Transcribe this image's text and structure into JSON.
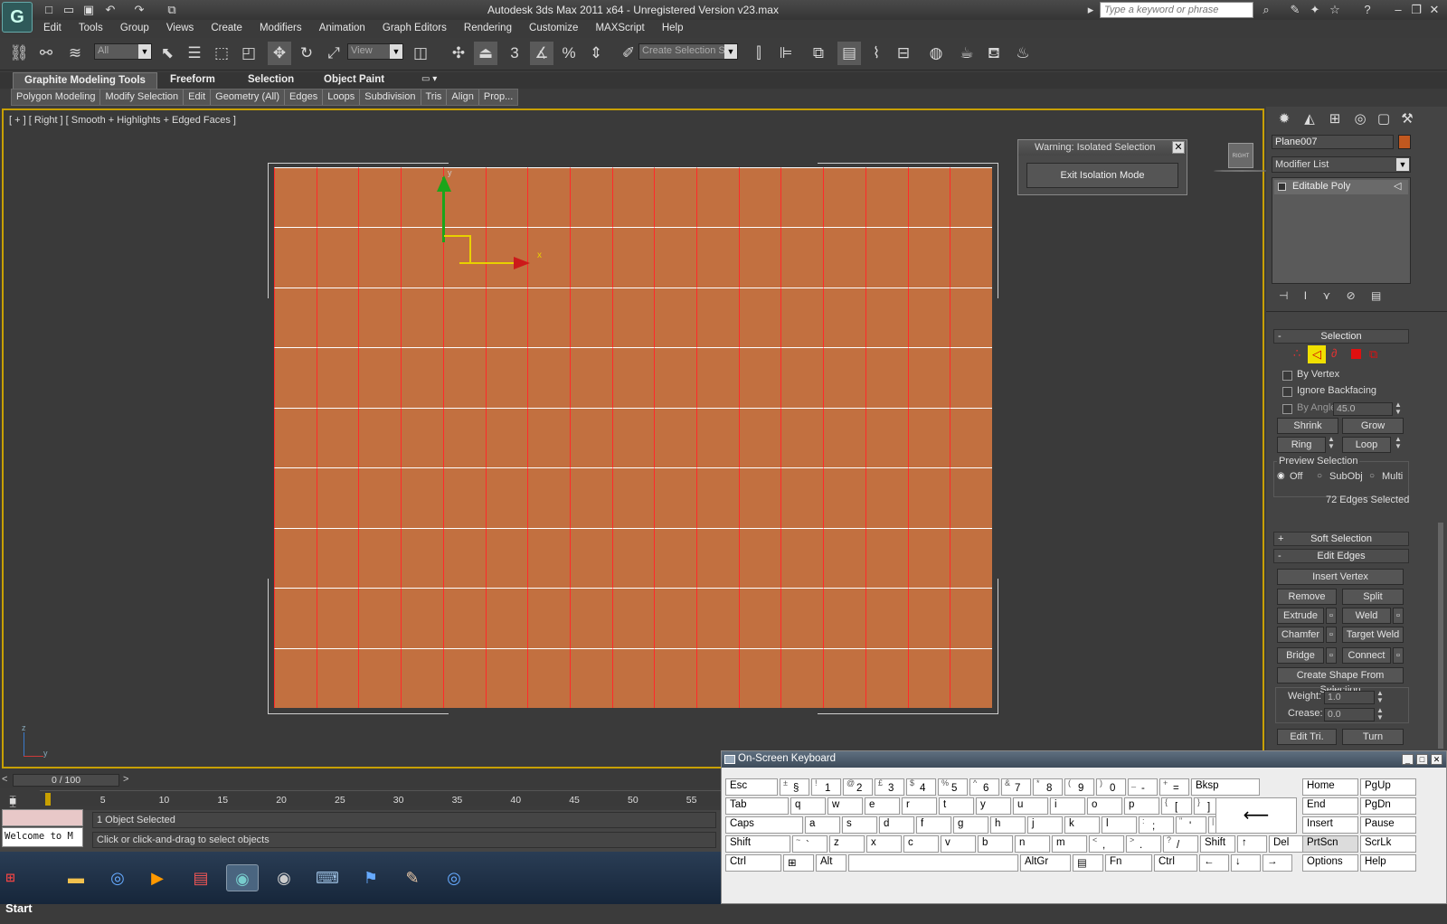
{
  "window": {
    "title": "Autodesk 3ds Max  2011 x64  - Unregistered Version   v23.max",
    "search_placeholder": "Type a keyword or phrase",
    "app_icon_glyph": "G"
  },
  "menu": [
    "Edit",
    "Tools",
    "Group",
    "Views",
    "Create",
    "Modifiers",
    "Animation",
    "Graph Editors",
    "Rendering",
    "Customize",
    "MAXScript",
    "Help"
  ],
  "toolbar": {
    "selection_filter": "All",
    "ref_coord": "View",
    "named_selection": "Create Selection Se"
  },
  "ribbon": {
    "tabs": [
      "Graphite Modeling Tools",
      "Freeform",
      "Selection",
      "Object Paint"
    ],
    "panels": [
      "Polygon Modeling",
      "Modify Selection",
      "Edit",
      "Geometry (All)",
      "Edges",
      "Loops",
      "Subdivision",
      "Tris",
      "Align",
      "Prop..."
    ]
  },
  "viewport": {
    "label": "[ + ] [ Right ] [ Smooth + Highlights + Edged Faces ]",
    "object_color": "#c27040",
    "grid_cols": 17,
    "grid_rows": 9,
    "gizmo_x": "x",
    "gizmo_y": "y",
    "axis_z": "z",
    "axis_y": "y",
    "viewcube_label": "RIGHT"
  },
  "warning_dialog": {
    "title": "Warning: Isolated Selection",
    "button": "Exit Isolation Mode"
  },
  "command_panel": {
    "object_name": "Plane007",
    "object_color": "#c1581f",
    "modifier_list": "Modifier List",
    "stack_item": "Editable Poly",
    "selection": {
      "title": "Selection",
      "by_vertex": "By Vertex",
      "ignore_backfacing": "Ignore Backfacing",
      "by_angle": "By Angle:",
      "angle_value": "45.0",
      "shrink": "Shrink",
      "grow": "Grow",
      "ring": "Ring",
      "loop": "Loop",
      "preview_title": "Preview Selection",
      "preview_off": "Off",
      "preview_subobj": "SubObj",
      "preview_multi": "Multi",
      "status": "72 Edges Selected"
    },
    "soft_selection": "Soft Selection",
    "edit_edges": {
      "title": "Edit Edges",
      "insert_vertex": "Insert Vertex",
      "remove": "Remove",
      "split": "Split",
      "extrude": "Extrude",
      "weld": "Weld",
      "chamfer": "Chamfer",
      "target_weld": "Target Weld",
      "bridge": "Bridge",
      "connect": "Connect",
      "create_shape": "Create Shape From Selection",
      "weight_label": "Weight:",
      "weight_value": "1.0",
      "crease_label": "Crease:",
      "crease_value": "0.0",
      "edit_tri": "Edit Tri.",
      "turn": "Turn"
    }
  },
  "timeline": {
    "slider": "0 / 100",
    "ticks": [
      "0",
      "5",
      "10",
      "15",
      "20",
      "25",
      "30",
      "35",
      "40",
      "45",
      "50",
      "55"
    ]
  },
  "status": {
    "script_text": "Welcome to M",
    "line1": "1 Object Selected",
    "line2": "Click or click-and-drag to select objects"
  },
  "taskbar": {
    "start": "Start"
  },
  "osk": {
    "title": "On-Screen Keyboard",
    "row1": [
      {
        "t": "",
        "m": "Esc"
      },
      {
        "t": "±",
        "m": "§"
      },
      {
        "t": "!",
        "m": "1"
      },
      {
        "t": "@",
        "m": "2"
      },
      {
        "t": "£",
        "m": "3"
      },
      {
        "t": "$",
        "m": "4"
      },
      {
        "t": "%",
        "m": "5"
      },
      {
        "t": "^",
        "m": "6"
      },
      {
        "t": "&",
        "m": "7"
      },
      {
        "t": "*",
        "m": "8"
      },
      {
        "t": "(",
        "m": "9"
      },
      {
        "t": ")",
        "m": "0"
      },
      {
        "t": "_",
        "m": "-"
      },
      {
        "t": "+",
        "m": "="
      },
      {
        "t": "",
        "m": "Bksp"
      }
    ],
    "row2": [
      {
        "t": "",
        "m": "Tab"
      },
      {
        "t": "",
        "m": "q"
      },
      {
        "t": "",
        "m": "w"
      },
      {
        "t": "",
        "m": "e"
      },
      {
        "t": "",
        "m": "r"
      },
      {
        "t": "",
        "m": "t"
      },
      {
        "t": "",
        "m": "y"
      },
      {
        "t": "",
        "m": "u"
      },
      {
        "t": "",
        "m": "i"
      },
      {
        "t": "",
        "m": "o"
      },
      {
        "t": "",
        "m": "p"
      },
      {
        "t": "{",
        "m": "["
      },
      {
        "t": "}",
        "m": "]"
      }
    ],
    "row3": [
      {
        "t": "",
        "m": "Caps"
      },
      {
        "t": "",
        "m": "a"
      },
      {
        "t": "",
        "m": "s"
      },
      {
        "t": "",
        "m": "d"
      },
      {
        "t": "",
        "m": "f"
      },
      {
        "t": "",
        "m": "g"
      },
      {
        "t": "",
        "m": "h"
      },
      {
        "t": "",
        "m": "j"
      },
      {
        "t": "",
        "m": "k"
      },
      {
        "t": "",
        "m": "l"
      },
      {
        "t": ":",
        "m": ";"
      },
      {
        "t": "\"",
        "m": "'"
      },
      {
        "t": "|",
        "m": "\\"
      }
    ],
    "row4": [
      {
        "t": "",
        "m": "Shift"
      },
      {
        "t": "~",
        "m": "`"
      },
      {
        "t": "",
        "m": "z"
      },
      {
        "t": "",
        "m": "x"
      },
      {
        "t": "",
        "m": "c"
      },
      {
        "t": "",
        "m": "v"
      },
      {
        "t": "",
        "m": "b"
      },
      {
        "t": "",
        "m": "n"
      },
      {
        "t": "",
        "m": "m"
      },
      {
        "t": "<",
        "m": ","
      },
      {
        "t": ">",
        "m": "."
      },
      {
        "t": "?",
        "m": "/"
      },
      {
        "t": "",
        "m": "Shift"
      },
      {
        "t": "",
        "m": "↑"
      },
      {
        "t": "",
        "m": "Del"
      }
    ],
    "row5": [
      {
        "t": "",
        "m": "Ctrl"
      },
      {
        "t": "",
        "m": "⊞"
      },
      {
        "t": "",
        "m": "Alt"
      },
      {
        "t": "",
        "m": ""
      },
      {
        "t": "",
        "m": "AltGr"
      },
      {
        "t": "",
        "m": "▤"
      },
      {
        "t": "",
        "m": "Fn"
      },
      {
        "t": "",
        "m": "Ctrl"
      },
      {
        "t": "",
        "m": "←"
      },
      {
        "t": "",
        "m": "↓"
      },
      {
        "t": "",
        "m": "→"
      }
    ],
    "nav": [
      "Home",
      "PgUp",
      "End",
      "PgDn",
      "Insert",
      "Pause",
      "PrtScn",
      "ScrLk",
      "Options",
      "Help"
    ],
    "enter_glyph": "⟵"
  }
}
